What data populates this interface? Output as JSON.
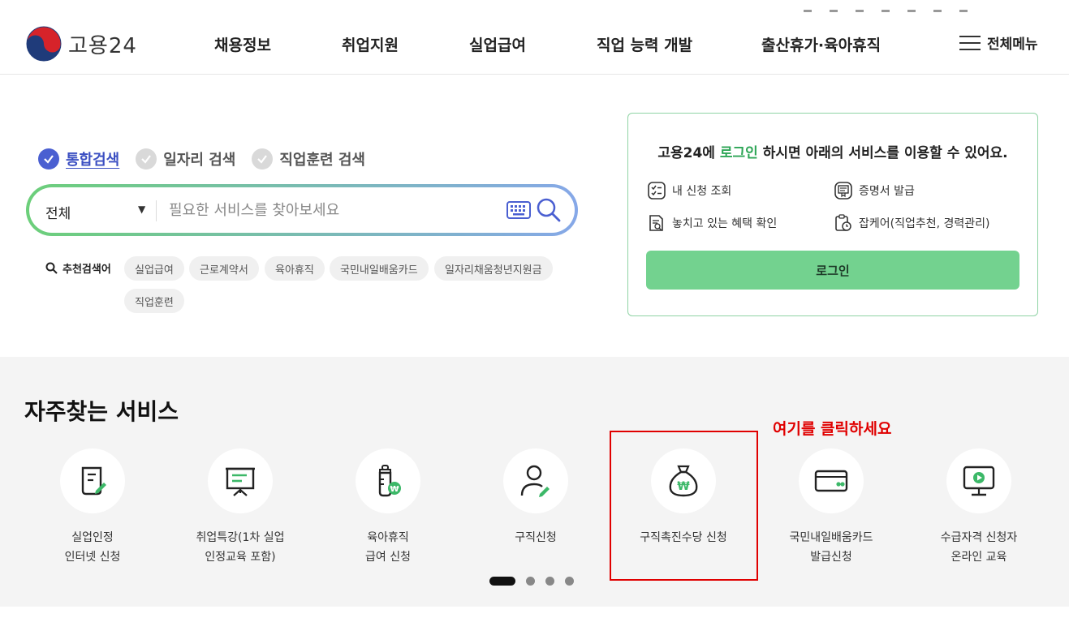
{
  "header": {
    "logo_text": "고용24",
    "nav": [
      "채용정보",
      "취업지원",
      "실업급여",
      "직업 능력 개발",
      "출산휴가·육아휴직"
    ],
    "menu_all": "전체메뉴"
  },
  "search": {
    "tabs": [
      {
        "label": "통합검색",
        "active": true
      },
      {
        "label": "일자리 검색",
        "active": false
      },
      {
        "label": "직업훈련 검색",
        "active": false
      }
    ],
    "scope_selected": "전체",
    "placeholder": "필요한 서비스를 찾아보세요",
    "recommended_label": "추천검색어",
    "recommended": [
      "실업급여",
      "근로계약서",
      "육아휴직",
      "국민내일배움카드",
      "일자리채움청년지원금",
      "직업훈련"
    ]
  },
  "login_box": {
    "msg_prefix": "고용24에 ",
    "msg_highlight": "로그인",
    "msg_suffix": " 하시면 아래의 서비스를 이용할 수 있어요.",
    "services": [
      "내 신청 조회",
      "증명서 발급",
      "놓치고 있는 혜택 확인",
      "잡케어(직업추천, 경력관리)"
    ],
    "button": "로그인"
  },
  "frequent": {
    "title": "자주찾는 서비스",
    "hint": "여기를 클릭하세요",
    "items": [
      {
        "label": "실업인정\n인터넷 신청",
        "icon": "document-pen-icon"
      },
      {
        "label": "취업특강(1차 실업\n인정교육 포함)",
        "icon": "presentation-board-icon"
      },
      {
        "label": "육아휴직\n급여 신청",
        "icon": "baby-bottle-icon"
      },
      {
        "label": "구직신청",
        "icon": "person-pen-icon"
      },
      {
        "label": "구직촉진수당 신청",
        "icon": "money-bag-icon"
      },
      {
        "label": "국민내일배움카드\n발급신청",
        "icon": "card-icon"
      },
      {
        "label": "수급자격 신청자\n온라인 교육",
        "icon": "monitor-play-icon"
      }
    ],
    "pager_count": 4,
    "pager_active": 1
  },
  "colors": {
    "accent_green": "#73d28f",
    "highlight_green": "#2da556",
    "active_tab": "#4a5fd1",
    "hint_red": "#e00000"
  }
}
